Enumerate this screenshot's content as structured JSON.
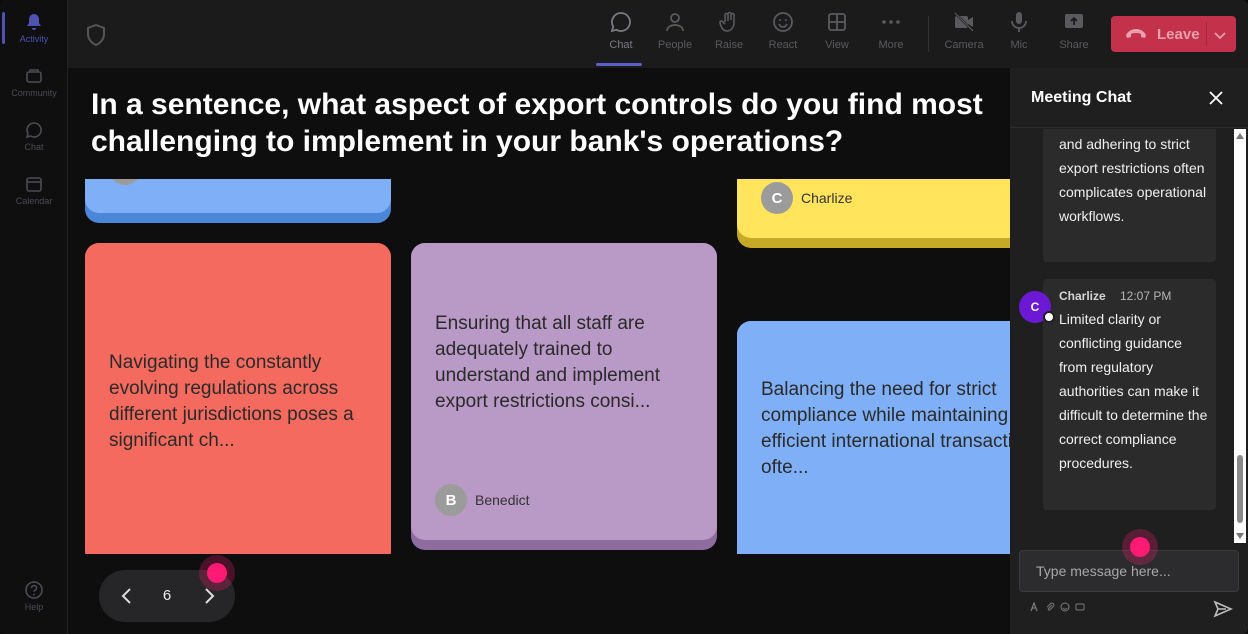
{
  "rail": {
    "items": [
      {
        "label": "Activity",
        "icon": "bell-icon",
        "active": true
      },
      {
        "label": "Community",
        "icon": "community-icon"
      },
      {
        "label": "Chat",
        "icon": "chat-icon"
      },
      {
        "label": "Calendar",
        "icon": "calendar-icon"
      }
    ],
    "help": "Help"
  },
  "topbar": {
    "buttons": [
      {
        "label": "Chat",
        "icon": "chat-icon",
        "active": true
      },
      {
        "label": "People",
        "icon": "people-icon"
      },
      {
        "label": "Raise",
        "icon": "raise-hand-icon"
      },
      {
        "label": "React",
        "icon": "react-icon"
      },
      {
        "label": "View",
        "icon": "view-icon"
      },
      {
        "label": "More",
        "icon": "more-icon"
      },
      {
        "label": "Camera",
        "icon": "camera-off-icon"
      },
      {
        "label": "Mic",
        "icon": "mic-icon"
      },
      {
        "label": "Share",
        "icon": "share-icon"
      }
    ],
    "leave_label": "Leave",
    "leave_color": "#c4314b"
  },
  "main": {
    "question": "In a sentence, what aspect of export controls do you find most challenging to implement in your bank's operations?",
    "cards": [
      {
        "text": "",
        "color": "#7fb0f7"
      },
      {
        "text": "",
        "author_initial": "C",
        "author": "Charlize",
        "color": "#ffe45c"
      },
      {
        "text": "Navigating the constantly evolving regulations across different jurisdictions poses a significant ch...",
        "color": "#f46a5f"
      },
      {
        "text": "Ensuring that all staff are adequately trained to understand and implement export restrictions consi...",
        "author_initial": "B",
        "author": "Benedict",
        "color": "#b999c6"
      },
      {
        "text": "Balancing the need for strict compliance while maintaining efficient international transactions ofte...",
        "color": "#7fb0f7"
      }
    ],
    "pager": {
      "page": "6"
    }
  },
  "chat": {
    "title": "Meeting Chat",
    "messages": [
      {
        "text": "and adhering to strict export restrictions often complicates operational workflows."
      },
      {
        "author_initial": "C",
        "author": "Charlize",
        "time": "12:07 PM",
        "text": "Limited clarity or conflicting guidance from regulatory authorities can make it difficult to determine the correct compliance procedures."
      }
    ],
    "input_placeholder": "Type message here...",
    "accent": "#6c19d6"
  }
}
